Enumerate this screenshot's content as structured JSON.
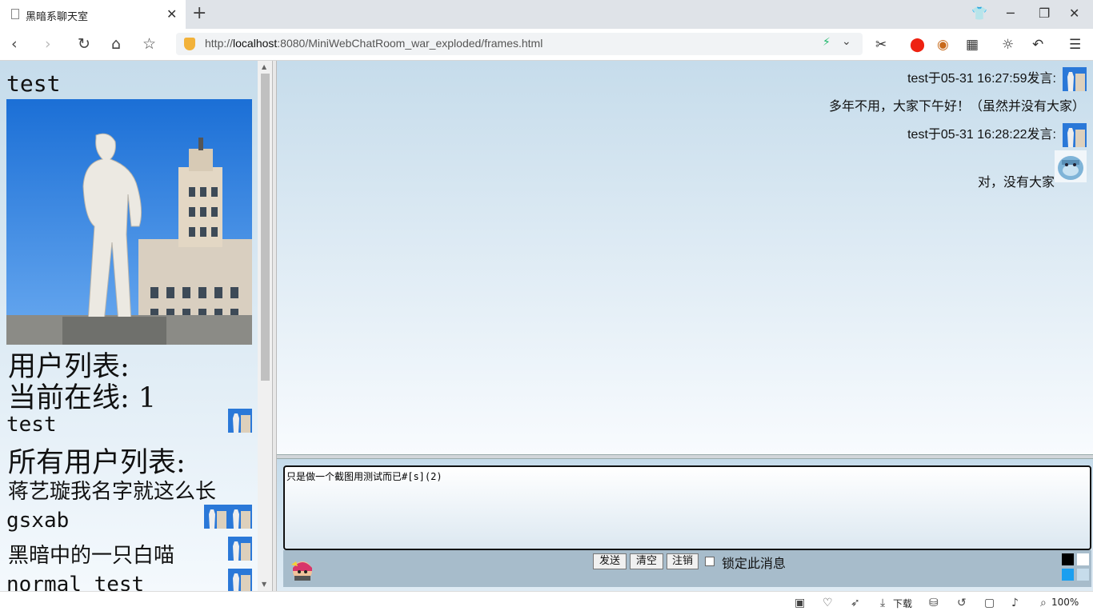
{
  "browser": {
    "tab_title": "黑暗系聊天室",
    "url_scheme": "http://",
    "url_host": "localhost",
    "url_rest": ":8080/MiniWebChatRoom_war_exploded/frames.html",
    "zoom": "100%",
    "download_label": "下载"
  },
  "sidebar": {
    "username": "test",
    "user_list_heading": "用户列表:",
    "online_label": "当前在线: 1",
    "online_users": [
      "test"
    ],
    "all_users_heading": "所有用户列表:",
    "all_users": [
      "蒋艺璇我名字就这么长",
      "gsxab",
      "黑暗中的一只白喵",
      "normal test"
    ]
  },
  "chat": {
    "messages": [
      {
        "header": "test于05-31 16:27:59发言:",
        "body": "多年不用，大家下午好！（虽然并没有大家）"
      },
      {
        "header": "test于05-31 16:28:22发言:",
        "body": "对，没有大家"
      }
    ]
  },
  "composer": {
    "input_value": "只是做一个截图用测试而已#[s](2)",
    "send_label": "发送",
    "clear_label": "清空",
    "logout_label": "注销",
    "lock_label": "锁定此消息",
    "colors": [
      "#000000",
      "#ffffff",
      "#1a9ff0",
      "#c6dceb"
    ]
  }
}
